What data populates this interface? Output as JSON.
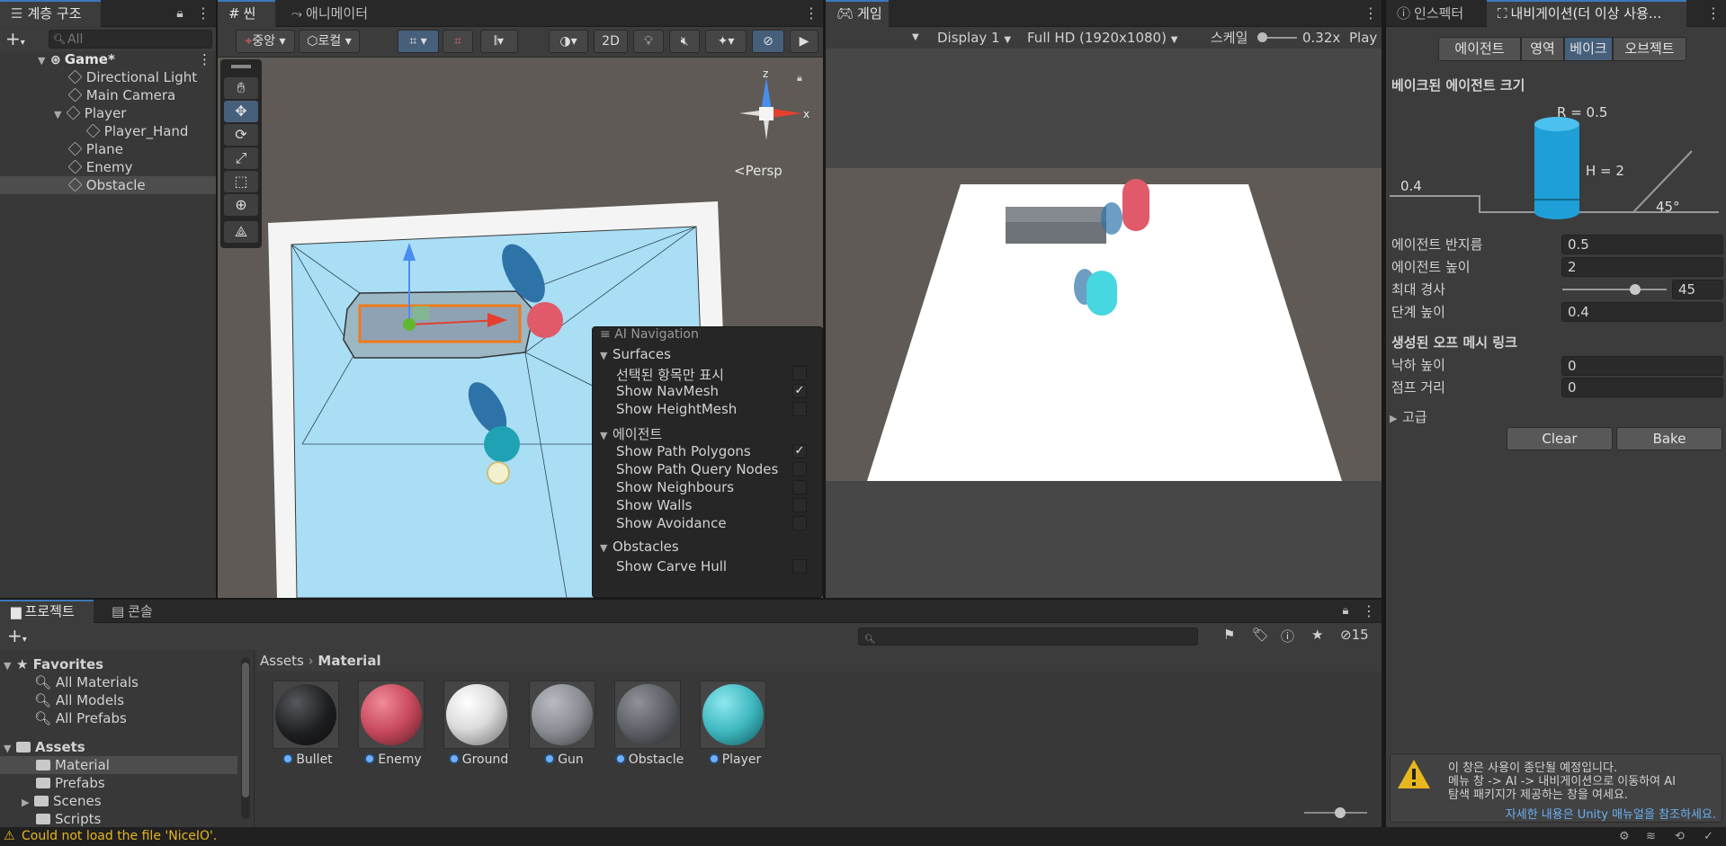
{
  "colors": {
    "accent": "#3a79bb",
    "selection": "#46607c",
    "navmesh": "#a9def5",
    "enemy": "#e05a6a",
    "player": "#47d7e0",
    "warning": "#e8b61e"
  },
  "hierarchy": {
    "tab": "계층 구조",
    "search_placeholder": "All",
    "root": "Game*",
    "items": [
      "Directional Light",
      "Main Camera",
      "Player",
      "Player_Hand",
      "Plane",
      "Enemy",
      "Obstacle"
    ]
  },
  "scene": {
    "tab_scene": "씬",
    "tab_animator": "애니메이터",
    "pivot": "중앙",
    "space": "로컬",
    "btn_2d": "2D",
    "persp": "Persp",
    "gizmo": {
      "z": "z",
      "x": "x"
    }
  },
  "ainav": {
    "title": "AI Navigation",
    "surfaces": "Surfaces",
    "surfaces_items": [
      {
        "label": "선택된 항목만 표시",
        "checked": false
      },
      {
        "label": "Show NavMesh",
        "checked": true
      },
      {
        "label": "Show HeightMesh",
        "checked": false
      }
    ],
    "agents": "에이전트",
    "agents_items": [
      {
        "label": "Show Path Polygons",
        "checked": true
      },
      {
        "label": "Show Path Query Nodes",
        "checked": false
      },
      {
        "label": "Show Neighbours",
        "checked": false
      },
      {
        "label": "Show Walls",
        "checked": false
      },
      {
        "label": "Show Avoidance",
        "checked": false
      }
    ],
    "obstacles": "Obstacles",
    "obstacles_items": [
      {
        "label": "Show Carve Hull",
        "checked": false
      }
    ],
    "check_mark": "✓"
  },
  "game": {
    "tab": "게임",
    "display": "Display 1",
    "resolution": "Full HD (1920x1080)",
    "scale_label": "스케일",
    "scale_value": "0.32x",
    "play": "Play"
  },
  "inspector": {
    "tab_inspector": "인스펙터",
    "tab_nav": "내비게이션(더 이상 사용...",
    "segments": [
      "에이전트",
      "영역",
      "베이크",
      "오브젝트"
    ],
    "selected_segment": 2,
    "section_agent": "베이크된 에이전트 크기",
    "diagram": {
      "r": "R = 0.5",
      "h": "H = 2",
      "step": "0.4",
      "slope": "45°"
    },
    "fields": [
      {
        "label": "에이전트 반지름",
        "value": "0.5"
      },
      {
        "label": "에이전트 높이",
        "value": "2"
      },
      {
        "label": "최대 경사",
        "value": "45",
        "slider": 0.67
      },
      {
        "label": "단계 높이",
        "value": "0.4"
      }
    ],
    "section_links": "생성된 오프 메시 링크",
    "link_fields": [
      {
        "label": "낙하 높이",
        "value": "0"
      },
      {
        "label": "점프 거리",
        "value": "0"
      }
    ],
    "advanced": "고급",
    "clear": "Clear",
    "bake": "Bake",
    "warning_text": [
      "이 창은 사용이 종단될 예정입니다.",
      "메뉴 창 -> AI -> 내비게이션으로 이동하여 AI",
      "탐색 패키지가 제공하는 창을 여세요."
    ],
    "warning_link": "자세한 내용은 Unity 매뉴얼을 참조하세요."
  },
  "project": {
    "tab_project": "프로젝트",
    "tab_console": "콘솔",
    "hidden_count": "15",
    "favorites": "Favorites",
    "fav_items": [
      "All Materials",
      "All Models",
      "All Prefabs"
    ],
    "assets": "Assets",
    "asset_folders": [
      "Material",
      "Prefabs",
      "Scenes",
      "Scripts"
    ],
    "breadcrumb": [
      "Assets",
      "Material"
    ],
    "materials": [
      {
        "name": "Bullet",
        "color": "#1d1e20"
      },
      {
        "name": "Enemy",
        "color": "#c8495c"
      },
      {
        "name": "Ground",
        "color": "#e8e8e8"
      },
      {
        "name": "Gun",
        "color": "#8a8e94"
      },
      {
        "name": "Obstacle",
        "color": "#5d6167"
      },
      {
        "name": "Player",
        "color": "#3fb8c0"
      }
    ]
  },
  "status": {
    "message": "Could not load the file 'NiceIO'."
  }
}
